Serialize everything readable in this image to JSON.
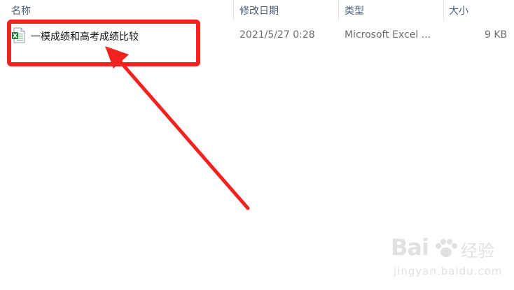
{
  "columns": {
    "name": "名称",
    "modified": "修改日期",
    "type": "类型",
    "size": "大小"
  },
  "file": {
    "name": "一模成绩和高考成绩比较",
    "modified": "2021/5/27 0:28",
    "type": "Microsoft Excel ...",
    "size": "9 KB",
    "icon": "excel-file-icon"
  },
  "annotation": {
    "box_color": "#f2231e",
    "arrow_color": "#f2231e"
  },
  "watermark": {
    "brand": "Bai",
    "brand2": "经验",
    "url": "jingyan.baidu.com"
  }
}
